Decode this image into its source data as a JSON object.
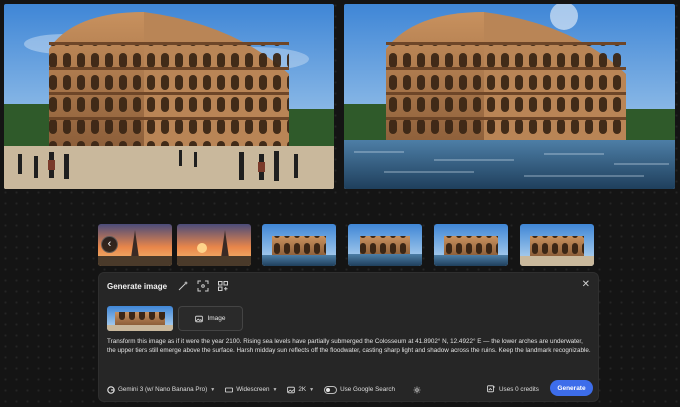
{
  "hero": {
    "left": {
      "description_icon": "colosseum-photo"
    },
    "right": {
      "description_icon": "colosseum-flooded-photo"
    }
  },
  "thumbnails": {
    "prev_icon": "chevron-left-icon",
    "prev_glyph": "‹",
    "count": 6
  },
  "panel": {
    "title": "Generate image",
    "close_glyph": "✕",
    "image_chip_label": "Image",
    "prompt": "Transform this image as if it were the year 2100. Rising sea levels have partially submerged the Colosseum at 41.8902° N, 12.4922° E — the lower arches are underwater, the upper tiers still emerge above the surface. Harsh midday sun reflects off the floodwater, casting sharp light and shadow across the ruins. Keep the landmark recognizable.",
    "model_label": "Gemini 3 (w/ Nano Banana Pro)",
    "aspect_label": "Widescreen",
    "resolution_label": "2K",
    "google_search_label": "Use Google Search",
    "credits_label": "Uses 0 credits",
    "generate_label": "Generate"
  },
  "colors": {
    "accent": "#3d6dea",
    "panel_bg": "#262626",
    "page_bg": "#141414"
  }
}
